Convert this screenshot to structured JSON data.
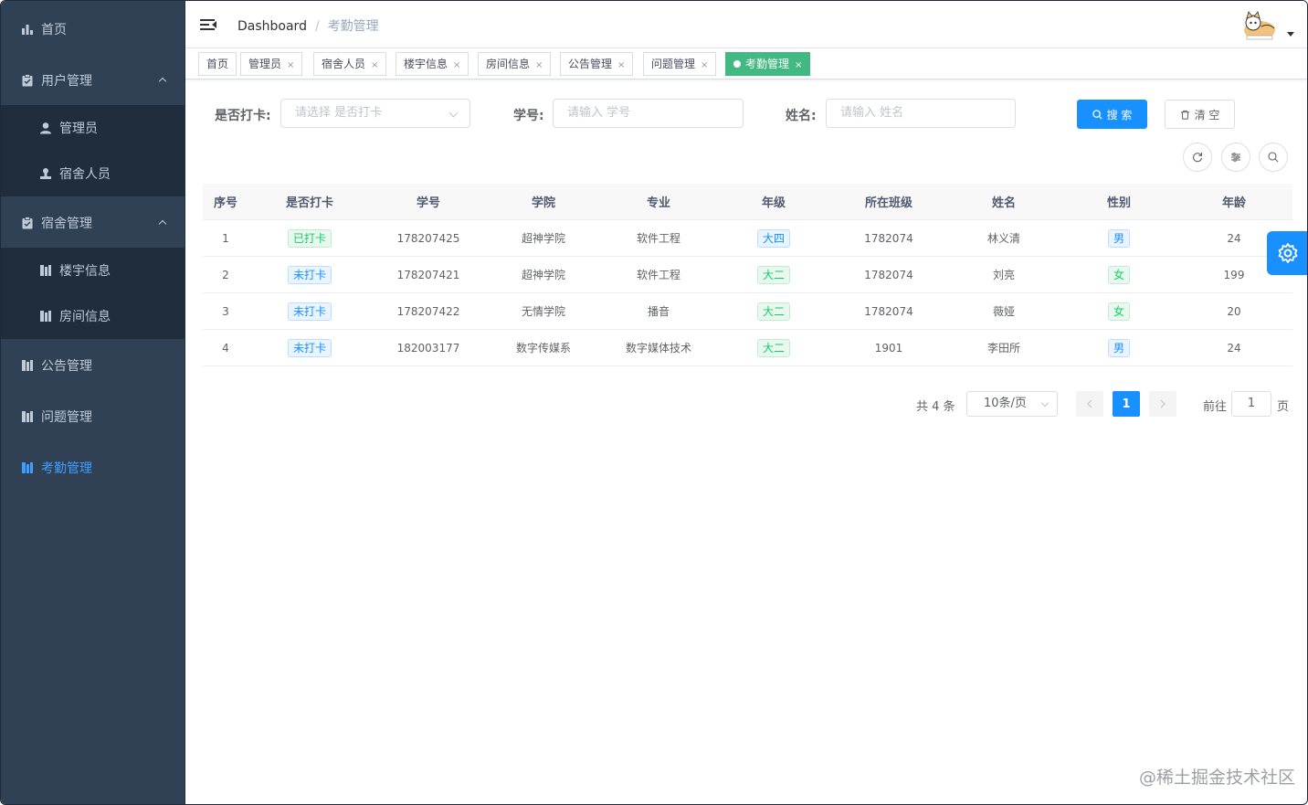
{
  "sidebar": {
    "items": [
      {
        "label": "首页",
        "icon": "chart-icon"
      },
      {
        "label": "用户管理",
        "icon": "clipboard-icon"
      },
      {
        "label": "管理员",
        "icon": "user-icon"
      },
      {
        "label": "宿舍人员",
        "icon": "user-stamp-icon"
      },
      {
        "label": "宿舍管理",
        "icon": "clipboard-icon"
      },
      {
        "label": "楼宇信息",
        "icon": "building-icon"
      },
      {
        "label": "房间信息",
        "icon": "building-icon"
      },
      {
        "label": "公告管理",
        "icon": "building-icon"
      },
      {
        "label": "问题管理",
        "icon": "building-icon"
      },
      {
        "label": "考勤管理",
        "icon": "building-icon"
      }
    ],
    "active_color": "#409eff",
    "bg_color": "#304156"
  },
  "header": {
    "breadcrumb_home": "Dashboard",
    "breadcrumb_sep": "/",
    "breadcrumb_current": "考勤管理"
  },
  "tags": [
    {
      "label": "首页",
      "closable": false
    },
    {
      "label": "管理员",
      "closable": true
    },
    {
      "label": "宿舍人员",
      "closable": true
    },
    {
      "label": "楼宇信息",
      "closable": true
    },
    {
      "label": "房间信息",
      "closable": true
    },
    {
      "label": "公告管理",
      "closable": true
    },
    {
      "label": "问题管理",
      "closable": true
    },
    {
      "label": "考勤管理",
      "closable": true,
      "active": true
    }
  ],
  "tag_close": "×",
  "search": {
    "checkin_label": "是否打卡:",
    "checkin_placeholder": "请选择 是否打卡",
    "student_no_label": "学号:",
    "student_no_placeholder": "请输入 学号",
    "name_label": "姓名:",
    "name_placeholder": "请输入 姓名",
    "search_button": "搜 索",
    "clear_button": "清 空"
  },
  "table": {
    "headers": [
      "序号",
      "是否打卡",
      "学号",
      "学院",
      "专业",
      "年级",
      "所在班级",
      "姓名",
      "性别",
      "年龄"
    ],
    "rows": [
      [
        "1",
        "已打卡",
        "178207425",
        "超神学院",
        "软件工程",
        "大四",
        "1782074",
        "林义清",
        "男",
        "24"
      ],
      [
        "2",
        "未打卡",
        "178207421",
        "超神学院",
        "软件工程",
        "大二",
        "1782074",
        "刘亮",
        "女",
        "199"
      ],
      [
        "3",
        "未打卡",
        "178207422",
        "无情学院",
        "播音",
        "大二",
        "1782074",
        "薇娅",
        "女",
        "20"
      ],
      [
        "4",
        "未打卡",
        "182003177",
        "数字传媒系",
        "数字媒体技术",
        "大二",
        "1901",
        "李田所",
        "男",
        "24"
      ]
    ]
  },
  "pagination": {
    "total": "共 4 条",
    "page_size": "10条/页",
    "current": "1",
    "goto_prefix": "前往",
    "goto_value": "1",
    "goto_suffix": "页"
  },
  "watermark": "@稀土掘金技术社区",
  "colors": {
    "primary": "#1890ff",
    "tag_active": "#42b983",
    "pill_green": "#13ce66"
  }
}
